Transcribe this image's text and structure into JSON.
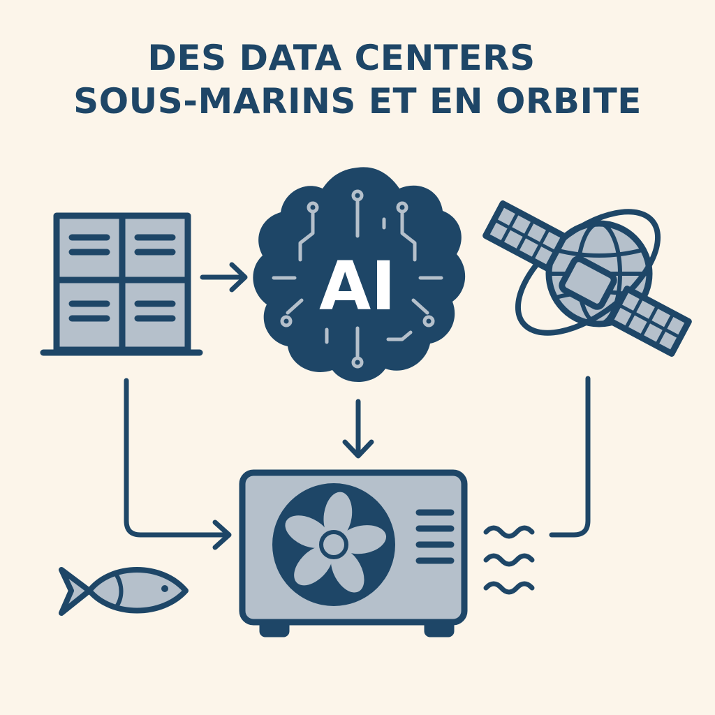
{
  "title": {
    "line1": "DES DATA CENTERS",
    "line2": "SOUS-MARINS ET EN ORBITE"
  },
  "ai_chip": {
    "label": "AI"
  },
  "icons": [
    "server-rack-icon",
    "ai-brain-chip-icon",
    "satellite-globe-icon",
    "cooling-unit-icon",
    "fish-icon",
    "water-waves-icon"
  ],
  "colors": {
    "background": "#fcf5ea",
    "navy": "#1e4667",
    "light_fill": "#b5c0cb",
    "white": "#ffffff"
  }
}
